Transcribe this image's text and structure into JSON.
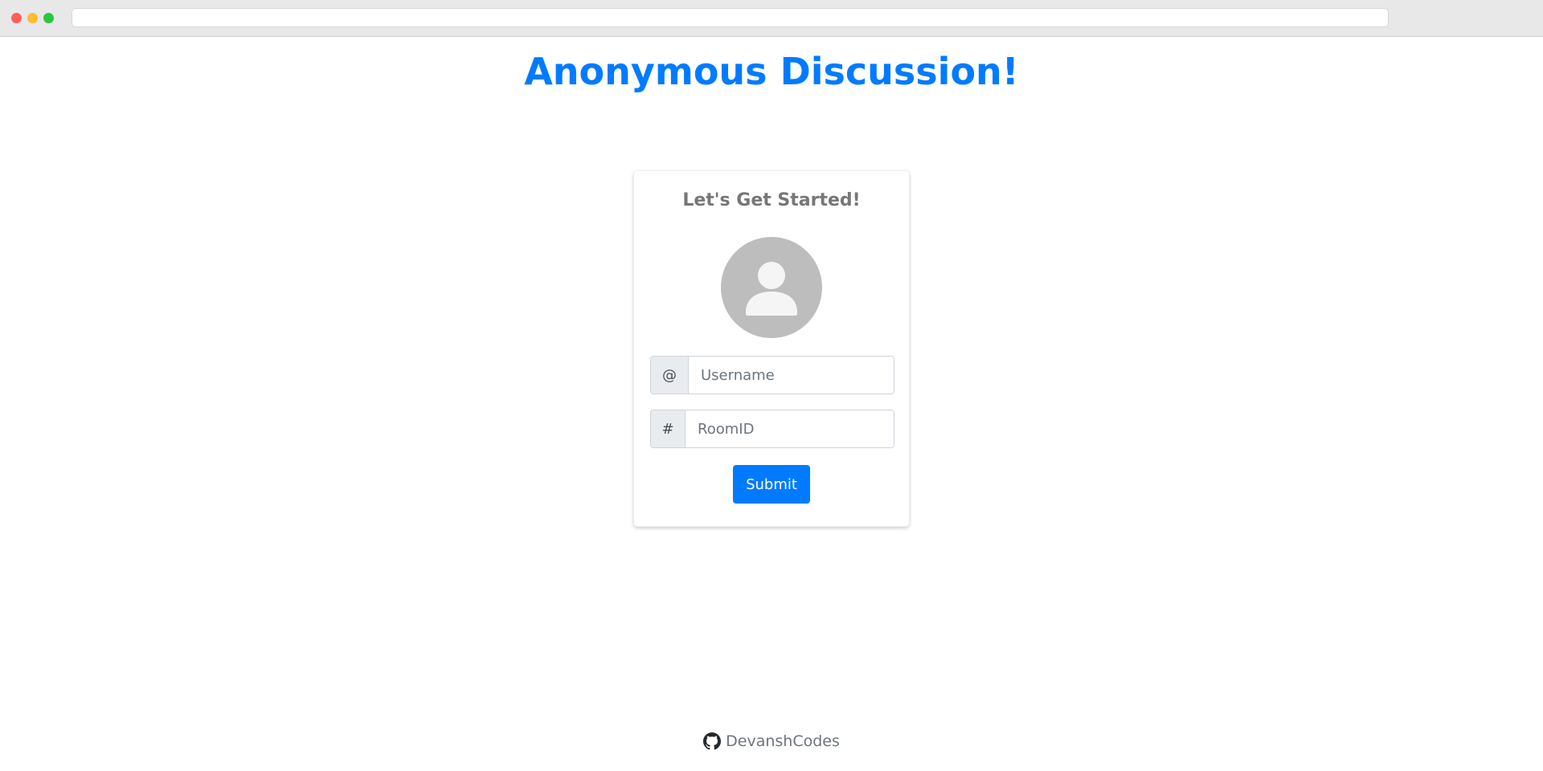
{
  "page": {
    "title": "Anonymous Discussion!"
  },
  "card": {
    "heading": "Let's Get Started!",
    "avatar_icon": "user-avatar-icon",
    "username_field": {
      "prefix": "@",
      "value": "",
      "placeholder": "Username"
    },
    "room_field": {
      "prefix": "#",
      "value": "",
      "placeholder": "RoomID"
    },
    "submit_label": "Submit"
  },
  "footer": {
    "icon": "github-icon",
    "link_text": "DevanshCodes"
  },
  "colors": {
    "accent": "#007bff",
    "heading_text": "#777777",
    "avatar_bg": "#bdbdbd",
    "prefix_bg": "#e9ecef"
  }
}
